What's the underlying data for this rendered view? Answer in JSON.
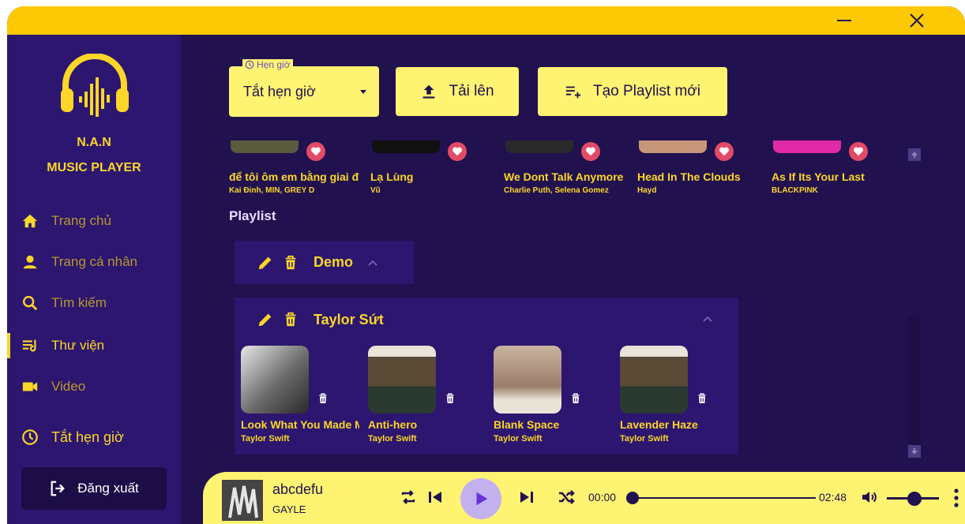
{
  "app": {
    "brand_line1": "N.A.N",
    "brand_line2": "MUSIC PLAYER"
  },
  "sidebar": {
    "items": [
      {
        "label": "Trang chủ",
        "icon": "home-icon",
        "active": false
      },
      {
        "label": "Trang cá nhân",
        "icon": "person-icon",
        "active": false
      },
      {
        "label": "Tìm kiếm",
        "icon": "search-icon",
        "active": false
      },
      {
        "label": "Thư viện",
        "icon": "library-icon",
        "active": true
      },
      {
        "label": "Video",
        "icon": "video-icon",
        "active": false
      }
    ],
    "timer_label": "Tắt hẹn giờ",
    "logout_label": "Đăng xuất"
  },
  "toolbar": {
    "timer_legend": "Hẹn giờ",
    "timer_value": "Tắt hẹn giờ",
    "upload_label": "Tải lên",
    "new_playlist_label": "Tạo Playlist mới"
  },
  "favorites": [
    {
      "title": "để tôi ôm em bằng giai điệu này",
      "artist": "Kai Đinh, MIN, GREY D"
    },
    {
      "title": "Lạ Lùng",
      "artist": "Vũ"
    },
    {
      "title": "We Dont Talk Anymore",
      "artist": "Charlie Puth, Selena Gomez"
    },
    {
      "title": "Head In The Clouds",
      "artist": "Hayd"
    },
    {
      "title": "As If Its Your Last",
      "artist": "BLACKPINK"
    }
  ],
  "playlist_section": {
    "title": "Playlist",
    "playlists": [
      {
        "name": "Demo",
        "expanded": false
      },
      {
        "name": "Taylor Sứt",
        "expanded": true,
        "tracks": [
          {
            "title": "Look What You Made Me Do",
            "artist": "Taylor Swift"
          },
          {
            "title": "Anti-hero",
            "artist": "Taylor Swift"
          },
          {
            "title": "Blank Space",
            "artist": "Taylor Swift"
          },
          {
            "title": "Lavender Haze",
            "artist": "Taylor Swift"
          }
        ]
      }
    ]
  },
  "player": {
    "title": "abcdefu",
    "artist": "GAYLE",
    "current_time": "00:00",
    "duration": "02:48",
    "progress": 0.0,
    "volume": 0.55
  },
  "colors": {
    "accent_yellow": "#fcd628",
    "titlebar": "#fcc904",
    "panel_yellow": "#fff372",
    "bg_dark": "#21114f",
    "sidebar": "#2c1670",
    "heart": "#e34a68",
    "play_button": "#c3b1ef"
  }
}
